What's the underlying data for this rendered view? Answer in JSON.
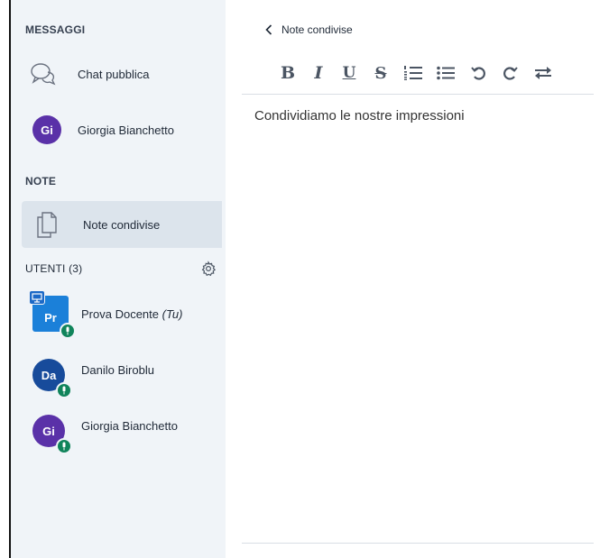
{
  "sidebar": {
    "messages_title": "MESSAGGI",
    "public_chat": "Chat pubblica",
    "private_chat": {
      "initials": "Gi",
      "name": "Giorgia Bianchetto",
      "color": "#5a31a8"
    },
    "notes_title": "NOTE",
    "shared_notes": "Note condivise",
    "users_title": "UTENTI (3)",
    "users": [
      {
        "initials": "Pr",
        "name": "Prova Docente",
        "you_tag": "(Tu)",
        "color": "#1b80d9",
        "presenter": true
      },
      {
        "initials": "Da",
        "name": "Danilo Biroblu",
        "color": "#174b9b"
      },
      {
        "initials": "Gi",
        "name": "Giorgia Bianchetto",
        "color": "#5a31a8"
      }
    ]
  },
  "main": {
    "back_label": "Note condivise",
    "editor_text": "Condividiamo le nostre impressioni",
    "toolbar": {
      "bold": "B",
      "italic": "I",
      "underline": "U",
      "strike": "S"
    }
  },
  "icons": {
    "chat": "chat-bubbles-icon",
    "notes": "document-icon",
    "gear": "gear-icon",
    "mic": "microphone-icon",
    "presenter": "presentation-icon"
  },
  "colors": {
    "sidebar_bg": "#f0f4f8",
    "active_bg": "#dce4ec",
    "mic_green": "#10845b"
  }
}
